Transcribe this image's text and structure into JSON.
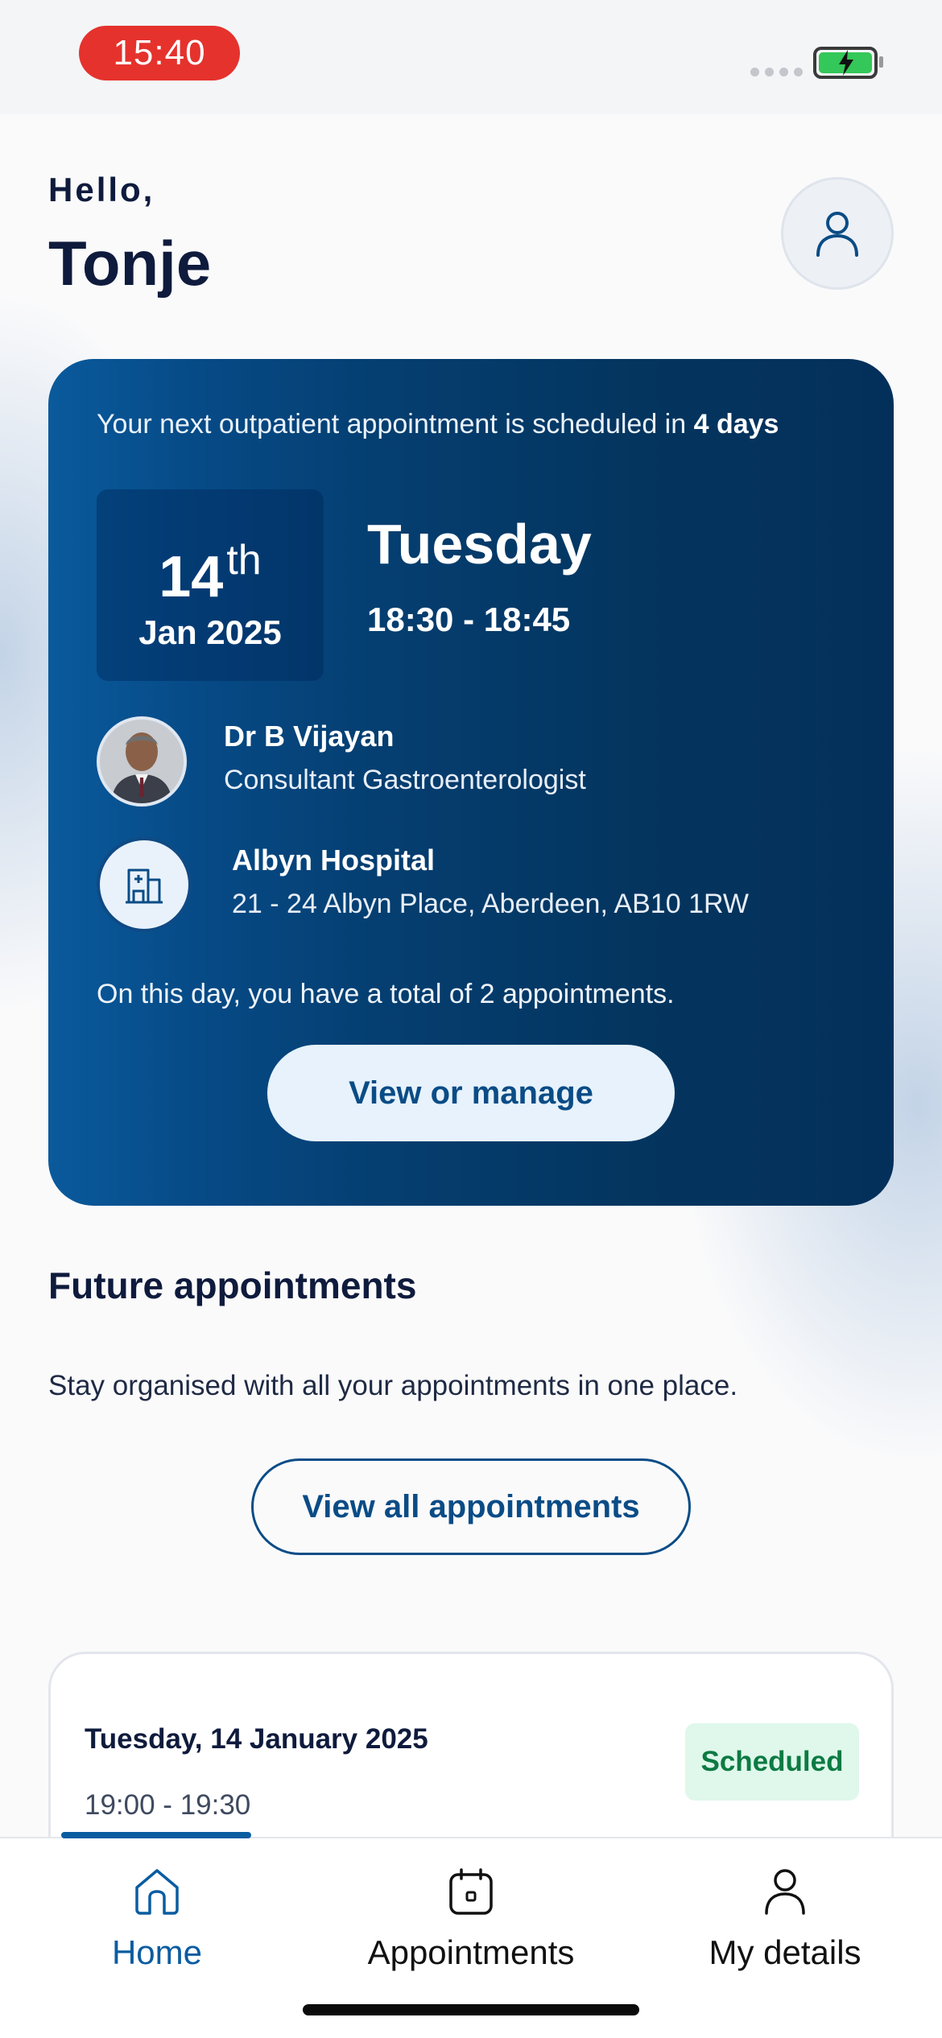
{
  "status_bar": {
    "time": "15:40",
    "battery_color": "#34c759",
    "time_pill_color": "#e5322d"
  },
  "greeting": {
    "hello": "Hello,",
    "name": "Tonje"
  },
  "next_appointment": {
    "intro_prefix": "Your next outpatient appointment is scheduled in ",
    "intro_emphasis": "4 days",
    "day": "14",
    "day_suffix": "th",
    "month_year": "Jan 2025",
    "weekday": "Tuesday",
    "time_range": "18:30 - 18:45",
    "doctor_name": "Dr B Vijayan",
    "doctor_role": "Consultant Gastroenterologist",
    "hospital_name": "Albyn Hospital",
    "hospital_address": "21 - 24 Albyn Place, Aberdeen, AB10 1RW",
    "total_text": "On this day, you have a total of 2 appointments.",
    "manage_label": "View or manage"
  },
  "future": {
    "title": "Future appointments",
    "subtitle": "Stay organised with all your appointments in one place.",
    "view_all_label": "View all appointments",
    "appointments": [
      {
        "date": "Tuesday, 14 January 2025",
        "time": "19:00 - 19:30",
        "status": "Scheduled"
      }
    ]
  },
  "tabbar": {
    "tabs": [
      {
        "label": "Home",
        "icon": "home-icon",
        "active": true
      },
      {
        "label": "Appointments",
        "icon": "calendar-icon",
        "active": false
      },
      {
        "label": "My details",
        "icon": "person-icon",
        "active": false
      }
    ]
  },
  "colors": {
    "brand_blue": "#0a4c86",
    "active_tab": "#0a5ca1",
    "scheduled_bg": "#dff8eb",
    "scheduled_text": "#0c7a43"
  }
}
